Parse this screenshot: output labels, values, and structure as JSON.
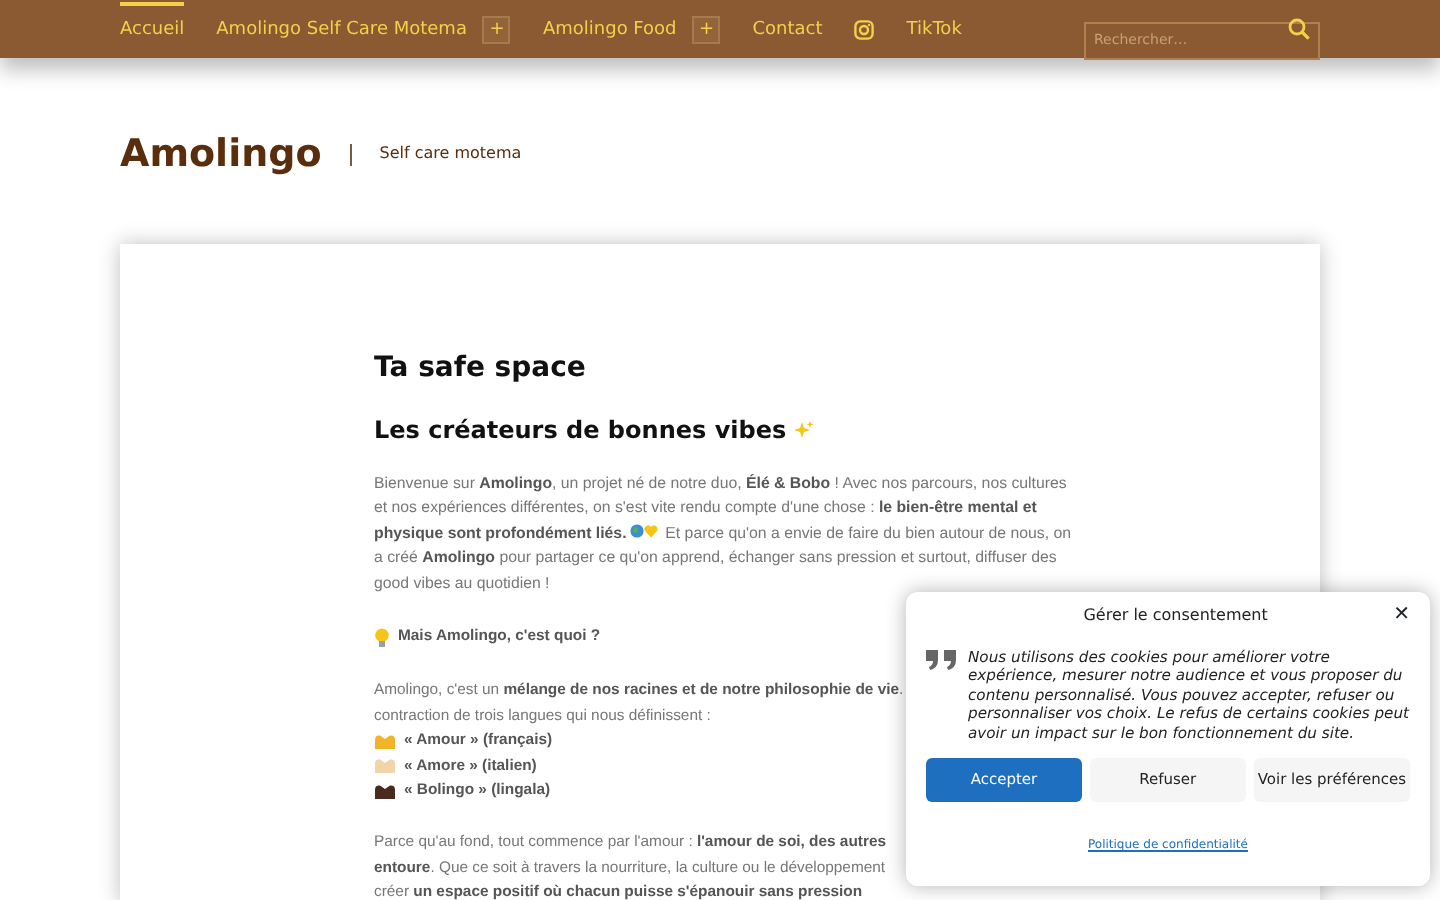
{
  "nav": {
    "items": [
      {
        "label": "Accueil",
        "selected": true,
        "kind": "link"
      },
      {
        "label": "Amolingo Self Care Motema",
        "selected": false,
        "kind": "link",
        "expander": "+"
      },
      {
        "label": "Amolingo Food",
        "selected": false,
        "kind": "link",
        "expander": "+"
      },
      {
        "label": "Contact",
        "selected": false,
        "kind": "link"
      },
      {
        "selected": false,
        "kind": "instagram"
      },
      {
        "label": "TikTok",
        "selected": false,
        "kind": "link"
      }
    ],
    "search": {
      "placeholder": "Rechercher…"
    }
  },
  "site": {
    "title": "Amolingo",
    "tagline": "Self care motema"
  },
  "article": {
    "title": "Ta safe space",
    "subtitle": "Les créateurs de bonnes vibes",
    "intro_before": "Bienvenue sur **Amolingo**, un projet né de notre duo, **Élé & Bobo** ! Avec nos parcours, nos cultures et nos expériences différentes, on s'est vite rendu compte d'une chose : **le bien-être mental et physique sont profondément liés.**",
    "intro_after": "Et parce qu'on a envie de faire du bien autour de nous, on a créé **Amolingo** pour partager ce qu'on apprend, échanger sans pression et surtout, diffuser des good vibes au quotidien !",
    "question": "Mais Amolingo, c'est quoi ?",
    "lines_a": [
      "Amolingo, c'est un **mélange de nos racines et de notre philosophie de vie**.",
      "contraction de trois langues qui nous définissent :"
    ],
    "languages": [
      {
        "text": "« Amour » (français)",
        "color": "#f0b429"
      },
      {
        "text": "« Amore » (italien)",
        "color": "#f3d3a8"
      },
      {
        "text": "« Bolingo » (lingala)",
        "color": "#4a2a1c"
      }
    ],
    "lines_b": [
      "Parce qu'au fond, tout commence par l'amour : **l'amour de soi, des autres**",
      "**entoure**. Que ce soit à travers la nourriture, la culture ou le développement",
      "créer **un espace positif où chacun puisse s'épanouir sans pression**"
    ]
  },
  "consent": {
    "title": "Gérer le consentement",
    "close": "✕",
    "text": "Nous utilisons des cookies pour améliorer votre expérience, mesurer notre audience et vous proposer du contenu personnalisé. Vous pouvez accepter, refuser ou personnaliser vos choix. Le refus de certains cookies peut avoir un impact sur le bon fonctionnement du site.",
    "buttons": [
      {
        "label": "Accepter",
        "kind": "primary"
      },
      {
        "label": "Refuser",
        "kind": "secondary"
      },
      {
        "label": "Voir les préférences",
        "kind": "secondary"
      }
    ],
    "link": "Politique de confidentialité"
  }
}
